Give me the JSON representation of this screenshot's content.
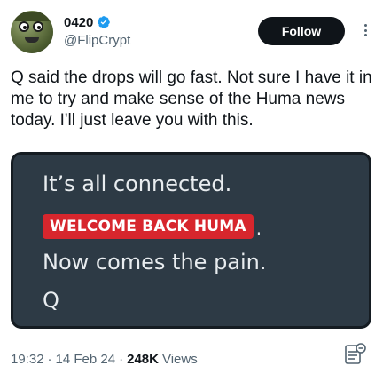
{
  "author": {
    "display_name": "0420",
    "handle": "@FlipCrypt",
    "verified": true
  },
  "follow_button": {
    "label": "Follow"
  },
  "tweet": {
    "text": "Q said the drops will go fast. Not sure I have it in me to try and make sense of the Huma news today. I'll just leave you with this."
  },
  "media": {
    "line1": "It’s all connected.",
    "highlight": "WELCOME BACK HUMA",
    "highlight_suffix": ".",
    "line3": "Now comes the pain.",
    "line4": "Q",
    "highlight_color": "#d7262d",
    "background_color": "#2d3a45"
  },
  "meta": {
    "time": "19:32",
    "date": "14 Feb 24",
    "views_count": "248K",
    "views_label": "Views"
  },
  "icons": {
    "verified": "verified-badge-icon",
    "more": "more-options-icon",
    "analytics": "analytics-icon"
  },
  "colors": {
    "verified_blue": "#1d9bf0",
    "text_primary": "#0f1419",
    "text_secondary": "#536471"
  }
}
